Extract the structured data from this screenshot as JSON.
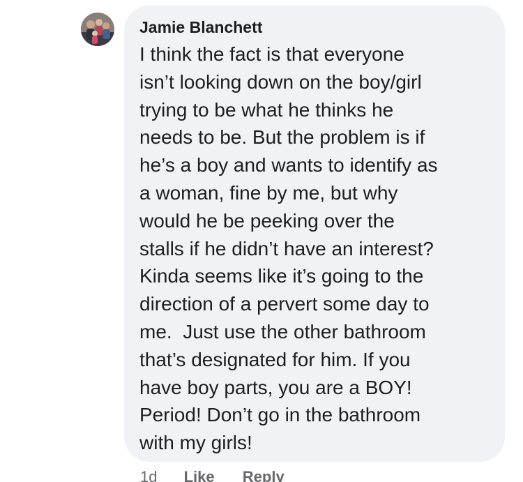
{
  "comment": {
    "avatar_icon": "profile-photo-avatar",
    "author": "Jamie Blanchett",
    "lines": [
      "I think the fact is that everyone",
      "isn’t looking down on the boy/girl",
      "trying to be what he thinks he",
      "needs to be. But the problem is if",
      "he’s a boy and wants to identify as",
      "a woman, fine by me, but why",
      "would he be peeking over the",
      "stalls if he didn’t have an interest?",
      "Kinda seems like it’s going to the",
      "direction of a pervert some day to",
      "me.  Just use the other bathroom",
      "that’s designated for him. If you",
      "have boy parts, you are a BOY!",
      "Period! Don’t go in the bathroom",
      "with my girls!"
    ],
    "timestamp": "1d",
    "like_label": "Like",
    "reply_label": "Reply",
    "colors": {
      "bubble_bg": "#f0f2f5",
      "text": "#1c1e21",
      "meta": "#65676b"
    }
  }
}
